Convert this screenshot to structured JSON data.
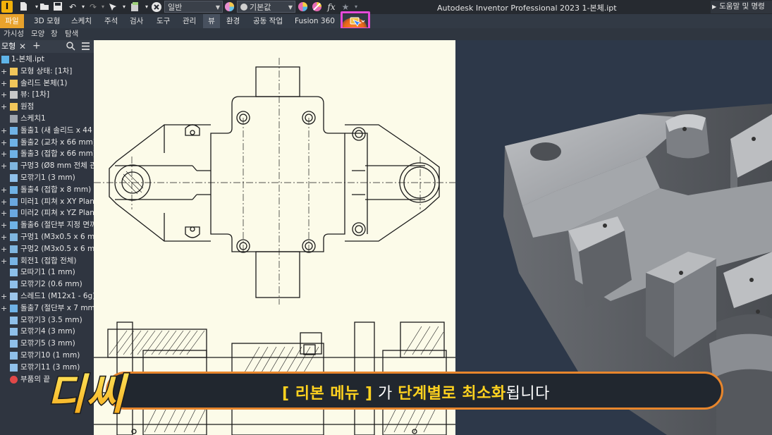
{
  "titlebar": {
    "app_title": "Autodesk Inventor Professional 2023    1-본체.ipt",
    "style_dropdown": "일반",
    "appearance_dropdown": "기본값",
    "help_menu": "도움말 및 명령"
  },
  "ribbon_tabs": [
    "파일",
    "3D 모형",
    "스케치",
    "주석",
    "검사",
    "도구",
    "관리",
    "뷰",
    "환경",
    "공동 작업",
    "Fusion 360"
  ],
  "active_tab": "뷰",
  "panel_tabs": [
    "가시성",
    "모양",
    "창",
    "탐색"
  ],
  "browser": {
    "title": "모형",
    "items": [
      {
        "label": "1-본체.ipt",
        "icon": "part-icon"
      },
      {
        "label": "모형 상태: [1차]",
        "icon": "folder-icon"
      },
      {
        "label": "솔리드 본체(1)",
        "icon": "folder-icon"
      },
      {
        "label": "뷰: [1차]",
        "icon": "view-icon"
      },
      {
        "label": "원점",
        "icon": "folder-icon"
      },
      {
        "label": "스케치1",
        "icon": "sketch-icon"
      },
      {
        "label": "돌출1 (새 솔리드 x 44 m",
        "icon": "extrude-icon"
      },
      {
        "label": "돌출2 (교차 x 66 mm)",
        "icon": "extrude-icon"
      },
      {
        "label": "돌출3 (접합 x 66 mm)",
        "icon": "extrude-icon"
      },
      {
        "label": "구멍3 (Ø8 mm 전체 관",
        "icon": "hole-icon"
      },
      {
        "label": "모깎기1 (3 mm)",
        "icon": "fillet-icon"
      },
      {
        "label": "돌출4 (접합 x 8 mm)",
        "icon": "extrude-icon"
      },
      {
        "label": "미러1 (피쳐 x XY Plan",
        "icon": "mirror-icon"
      },
      {
        "label": "미러2 (피쳐 x YZ Plane",
        "icon": "mirror-icon"
      },
      {
        "label": "돌출6 (절단부 지정 면까",
        "icon": "extrude-icon"
      },
      {
        "label": "구멍1 (M3x0.5 x 6 mm",
        "icon": "hole-icon"
      },
      {
        "label": "구멍2 (M3x0.5 x 6 mm",
        "icon": "hole-icon"
      },
      {
        "label": "회전1 (접합 전체)",
        "icon": "revolve-icon"
      },
      {
        "label": "모따기1 (1 mm)",
        "icon": "chamfer-icon"
      },
      {
        "label": "모깎기2 (0.6 mm)",
        "icon": "fillet-icon"
      },
      {
        "label": "스레드1 (M12x1 - 6g)",
        "icon": "thread-icon"
      },
      {
        "label": "돌출7 (절단부 x 7 mm)",
        "icon": "extrude-icon"
      },
      {
        "label": "모깎기3 (3.5 mm)",
        "icon": "fillet-icon"
      },
      {
        "label": "모깎기4 (3 mm)",
        "icon": "fillet-icon"
      },
      {
        "label": "모깎기5 (3 mm)",
        "icon": "fillet-icon"
      },
      {
        "label": "모깎기10 (1 mm)",
        "icon": "fillet-icon"
      },
      {
        "label": "모깎기11 (3 mm)",
        "icon": "fillet-icon"
      },
      {
        "label": "부품의 끝",
        "icon": "end-of-part-icon"
      }
    ]
  },
  "caption": {
    "part1": "[ 리본 메뉴 ]",
    "part2": " 가 ",
    "part3": "단계별로 최소화",
    "part4": "됩니다"
  },
  "logo_text": "디씨",
  "colors": {
    "accent_orange": "#e8862c",
    "highlight_pink": "#e64ad8",
    "caption_yellow": "#ffd21f",
    "file_tab": "#e8a22c"
  }
}
